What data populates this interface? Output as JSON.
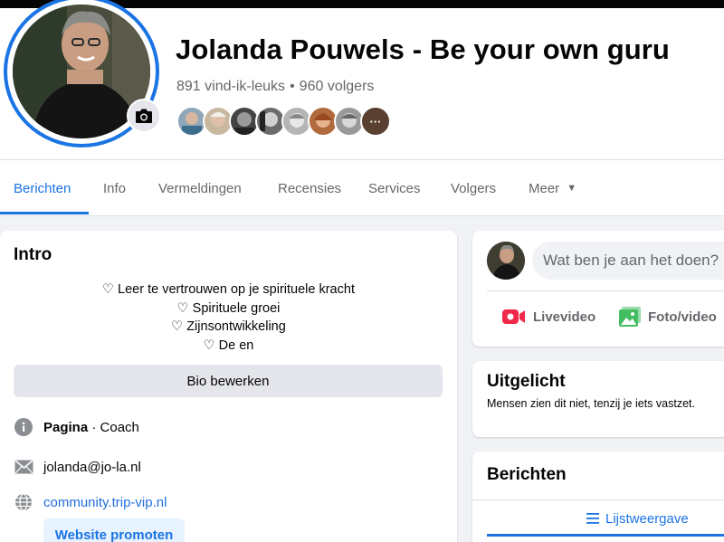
{
  "page": {
    "name": "Jolanda Pouwels - Be your own guru",
    "likes": "891 vind-ik-leuks",
    "separator": "•",
    "followers": "960 volgers"
  },
  "friends": {
    "more_label": "···"
  },
  "tabs": [
    {
      "label": "Berichten",
      "active": true
    },
    {
      "label": "Info"
    },
    {
      "label": "Vermeldingen"
    },
    {
      "label": "Recensies"
    },
    {
      "label": "Services"
    },
    {
      "label": "Volgers"
    },
    {
      "label": "Meer"
    }
  ],
  "intro": {
    "title": "Intro",
    "bio_lines": [
      "♡ Leer te vertrouwen op je spirituele kracht",
      "♡ Spirituele groei",
      "♡ Zijnsontwikkeling",
      "♡ De en"
    ],
    "edit_bio": "Bio bewerken",
    "category_label": "Pagina",
    "category_value": "· Coach",
    "email": "jolanda@jo-la.nl",
    "website": "community.trip-vip.nl",
    "promote_website": "Website promoten"
  },
  "composer": {
    "placeholder": "Wat ben je aan het doen?",
    "live_video": "Livevideo",
    "photo_video": "Foto/video"
  },
  "featured": {
    "title": "Uitgelicht",
    "subtitle": "Mensen zien dit niet, tenzij je iets vastzet."
  },
  "posts": {
    "title": "Berichten",
    "list_view": "Lijstweergave"
  },
  "colors": {
    "accent": "#1b74e4",
    "link": "#216fdb",
    "muted": "#65676b",
    "button_bg": "#e4e6eb",
    "live_red": "#f02849",
    "photo_green": "#45bd62"
  }
}
